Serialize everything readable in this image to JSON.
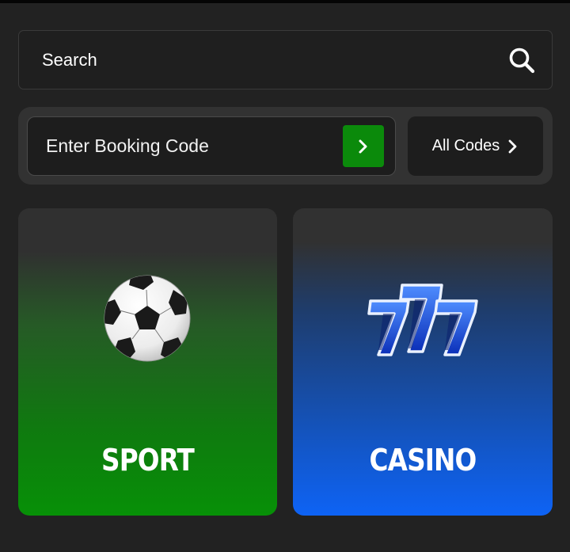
{
  "search": {
    "placeholder": "Search",
    "icon": "search-icon"
  },
  "booking": {
    "placeholder": "Enter Booking Code",
    "submit_icon": "chevron-right-icon",
    "submit_color": "#0b8a0b",
    "all_codes_label": "All Codes",
    "all_codes_icon": "chevron-right-icon"
  },
  "cards": [
    {
      "label": "SPORT",
      "icon": "soccer-ball-icon",
      "accent": "#079007"
    },
    {
      "label": "CASINO",
      "icon": "slot-777-icon",
      "accent": "#0e63f5"
    }
  ],
  "colors": {
    "background": "#222222",
    "panel": "#323232",
    "field": "#1d1d1d",
    "text": "#ffffff"
  }
}
